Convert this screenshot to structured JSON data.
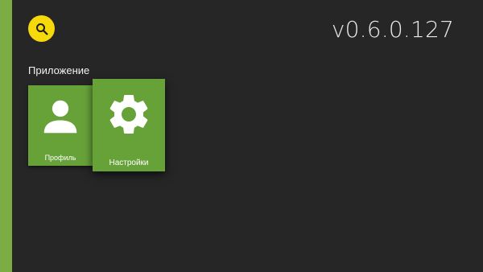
{
  "app": {
    "version": "v0.6.0.127",
    "accent_color": "#7cad45",
    "search_button_color": "#f5d90a"
  },
  "search": {
    "icon": "search-icon"
  },
  "rows": [
    {
      "title": "Приложение",
      "cards": [
        {
          "label": "Профиль",
          "icon": "person-icon"
        },
        {
          "label": "Настройки",
          "icon": "gear-icon"
        }
      ]
    }
  ]
}
